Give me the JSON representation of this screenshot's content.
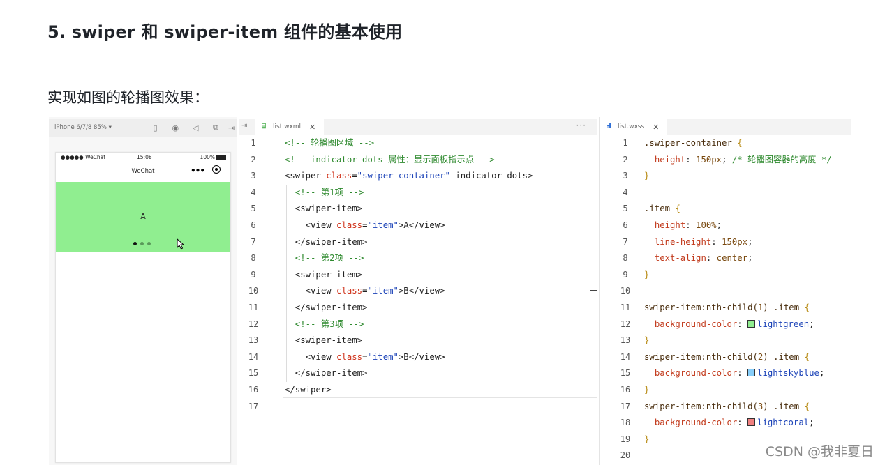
{
  "heading": "5. swiper 和 swiper-item 组件的基本使用",
  "subheading": "实现如图的轮播图效果：",
  "simulator": {
    "device_label": "iPhone 6/7/8 85% ▾",
    "status": {
      "carrier": "●●●●● WeChat",
      "time": "15:08",
      "battery": "100%"
    },
    "nav_title": "WeChat",
    "slide_text": "A",
    "swiper_color": "#90ee90",
    "dots": {
      "count": 3,
      "active": 0
    },
    "icons": [
      "phone-icon",
      "record-icon",
      "volume-icon",
      "window-icon",
      "split-icon",
      "more-icon",
      "target-icon",
      "cursor-icon"
    ]
  },
  "wxml_tab": {
    "filename": "list.wxml",
    "close": "✕",
    "more": "···"
  },
  "wxss_tab": {
    "filename": "list.wxss",
    "close": "✕"
  },
  "wxml_lines": [
    {
      "n": "1",
      "text": "<!-- 轮播图区域 -->"
    },
    {
      "n": "2",
      "text": "<!-- indicator-dots 属性：显示面板指示点 -->"
    },
    {
      "n": "3",
      "text": "<swiper class=\"swiper-container\" indicator-dots>"
    },
    {
      "n": "4",
      "text": "  <!-- 第1项 -->"
    },
    {
      "n": "5",
      "text": "  <swiper-item>"
    },
    {
      "n": "6",
      "text": "    <view class=\"item\">A</view>"
    },
    {
      "n": "7",
      "text": "  </swiper-item>"
    },
    {
      "n": "8",
      "text": "  <!-- 第2项 -->"
    },
    {
      "n": "9",
      "text": "  <swiper-item>"
    },
    {
      "n": "10",
      "text": "    <view class=\"item\">B</view>"
    },
    {
      "n": "11",
      "text": "  </swiper-item>"
    },
    {
      "n": "12",
      "text": "  <!-- 第3项 -->"
    },
    {
      "n": "13",
      "text": "  <swiper-item>"
    },
    {
      "n": "14",
      "text": "    <view class=\"item\">B</view>"
    },
    {
      "n": "15",
      "text": "  </swiper-item>"
    },
    {
      "n": "16",
      "text": "</swiper>"
    },
    {
      "n": "17",
      "text": ""
    }
  ],
  "wxss_lines": [
    {
      "n": "1",
      "text": ".swiper-container {"
    },
    {
      "n": "2",
      "text": "  height: 150px; /* 轮播图容器的高度 */"
    },
    {
      "n": "3",
      "text": "}"
    },
    {
      "n": "4",
      "text": ""
    },
    {
      "n": "5",
      "text": ".item {"
    },
    {
      "n": "6",
      "text": "  height: 100%;"
    },
    {
      "n": "7",
      "text": "  line-height: 150px;"
    },
    {
      "n": "8",
      "text": "  text-align: center;"
    },
    {
      "n": "9",
      "text": "}"
    },
    {
      "n": "10",
      "text": ""
    },
    {
      "n": "11",
      "text": "swiper-item:nth-child(1) .item {"
    },
    {
      "n": "12",
      "text": "  background-color: lightgreen;"
    },
    {
      "n": "13",
      "text": "}"
    },
    {
      "n": "14",
      "text": "swiper-item:nth-child(2) .item {"
    },
    {
      "n": "15",
      "text": "  background-color: lightskyblue;"
    },
    {
      "n": "16",
      "text": "}"
    },
    {
      "n": "17",
      "text": "swiper-item:nth-child(3) .item {"
    },
    {
      "n": "18",
      "text": "  background-color: lightcoral;"
    },
    {
      "n": "19",
      "text": "}"
    },
    {
      "n": "20",
      "text": ""
    }
  ],
  "swatches": {
    "lightgreen": "#90ee90",
    "lightskyblue": "#87cefa",
    "lightcoral": "#f08080"
  },
  "watermark": "CSDN @我非夏日"
}
